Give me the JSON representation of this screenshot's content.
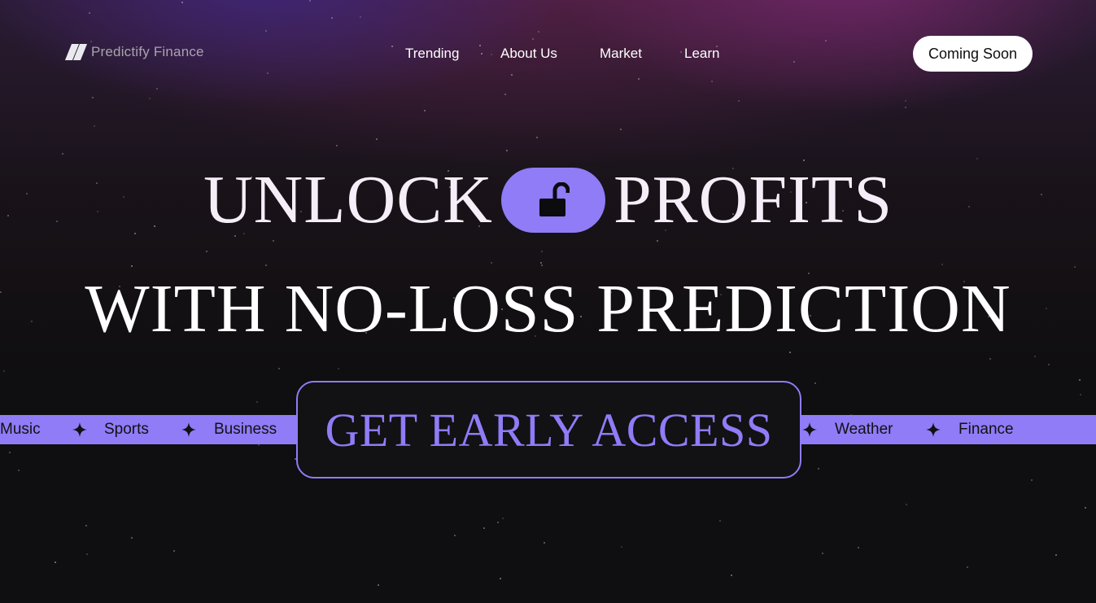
{
  "brand": {
    "name": "Predictify Finance",
    "logo_icon": "parallelogram-logo-icon"
  },
  "nav": {
    "items": [
      {
        "label": "Trending"
      },
      {
        "label": "About Us"
      },
      {
        "label": "Market"
      },
      {
        "label": "Learn"
      }
    ],
    "cta_label": "Coming Soon"
  },
  "hero": {
    "headline_word_1": "UNLOCK",
    "headline_icon": "unlocked-padlock-icon",
    "headline_word_2": "PROFITS",
    "headline_line_2": "WITH NO-LOSS PREDICTION",
    "cta_label": "GET EARLY ACCESS"
  },
  "ticker": {
    "separator_icon": "four-point-star-icon",
    "items": [
      {
        "label": "Music"
      },
      {
        "label": "Sports"
      },
      {
        "label": "Business"
      },
      {
        "label": "Weather"
      },
      {
        "label": "Finance"
      }
    ]
  },
  "colors": {
    "accent": "#8f7cf6",
    "background": "#0f0e10",
    "button_bg": "#ffffff"
  }
}
